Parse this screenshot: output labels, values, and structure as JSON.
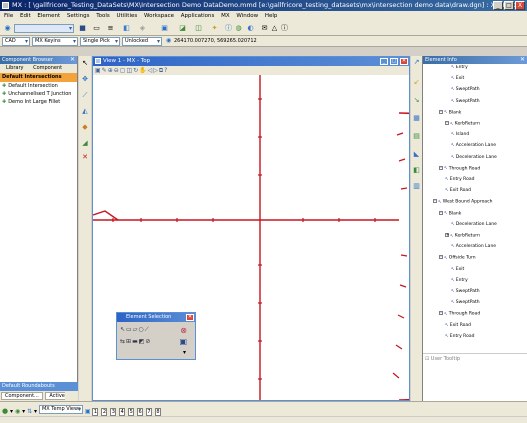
{
  "window": {
    "title": "MX : [ \\gallfricore_Testing_DataSets\\MX\\Intersection Demo DataDemo.mmd   [e:\\gallfricore_testing_datasets\\mx\\intersection demo data\\draw.dgn]  : XM Edition",
    "minimize": "_",
    "maximize": "□",
    "close": "X"
  },
  "menu": [
    "File",
    "Edit",
    "Element",
    "Settings",
    "Tools",
    "Utilities",
    "Workspace",
    "Applications",
    "MX",
    "Window",
    "Help"
  ],
  "toolbar2": {
    "level": "CAD",
    "style": "MX Keyins",
    "mode": "Single Pick",
    "lock": "Unlocked",
    "coords": "264170.007270, 569265.020712"
  },
  "left_panel": {
    "title": "Component Browser",
    "tabs": [
      "Library",
      "Component"
    ],
    "section": "Default Intersections",
    "items": [
      "Default Intersection",
      "Unchannelised T Junction",
      "Demo Int Large Fillet"
    ],
    "bottom_header": "Default Roundabouts",
    "bottom_tabs": [
      "Component...",
      "Active Design"
    ]
  },
  "view": {
    "title": "View 1 - MX - Top"
  },
  "element_selection": {
    "title": "Element Selection"
  },
  "right_panel": {
    "title": "Element Info",
    "tree": [
      {
        "label": "Entry",
        "indent": 4,
        "box": ""
      },
      {
        "label": "Exit",
        "indent": 4,
        "box": ""
      },
      {
        "label": "SweptPath",
        "indent": 4,
        "box": ""
      },
      {
        "label": "SweptPath",
        "indent": 4,
        "box": ""
      },
      {
        "label": "Blank",
        "indent": 2,
        "box": "-"
      },
      {
        "label": "KerbReturn",
        "indent": 3,
        "box": "-"
      },
      {
        "label": "Island",
        "indent": 4,
        "box": ""
      },
      {
        "label": "Acceleration Lane",
        "indent": 4,
        "box": ""
      },
      {
        "label": "Deceleration Lane",
        "indent": 4,
        "box": ""
      },
      {
        "label": "Through Road",
        "indent": 2,
        "box": "-"
      },
      {
        "label": "Entry Road",
        "indent": 3,
        "box": ""
      },
      {
        "label": "Exit Road",
        "indent": 3,
        "box": ""
      },
      {
        "label": "West Bound Approach",
        "indent": 1,
        "box": "-"
      },
      {
        "label": "Blank",
        "indent": 2,
        "box": "-"
      },
      {
        "label": "Deceleration Lane",
        "indent": 4,
        "box": ""
      },
      {
        "label": "KerbReturn",
        "indent": 3,
        "box": "+"
      },
      {
        "label": "Acceleration Lane",
        "indent": 4,
        "box": ""
      },
      {
        "label": "Offside Turn",
        "indent": 2,
        "box": "-"
      },
      {
        "label": "Exit",
        "indent": 4,
        "box": ""
      },
      {
        "label": "Entry",
        "indent": 4,
        "box": ""
      },
      {
        "label": "SweptPath",
        "indent": 4,
        "box": ""
      },
      {
        "label": "SweptPath",
        "indent": 4,
        "box": ""
      },
      {
        "label": "Through Road",
        "indent": 2,
        "box": "-"
      },
      {
        "label": "Exit Road",
        "indent": 3,
        "box": ""
      },
      {
        "label": "Entry Road",
        "indent": 3,
        "box": ""
      }
    ],
    "user_tooltip": "User Tooltip"
  },
  "statusbar": {
    "view_combo": "MX Temp Views",
    "pages": [
      "1",
      "2",
      "3",
      "4",
      "5",
      "6",
      "7",
      "8"
    ]
  },
  "colors": {
    "road": "#c8141e",
    "accent": "#0a246a"
  }
}
